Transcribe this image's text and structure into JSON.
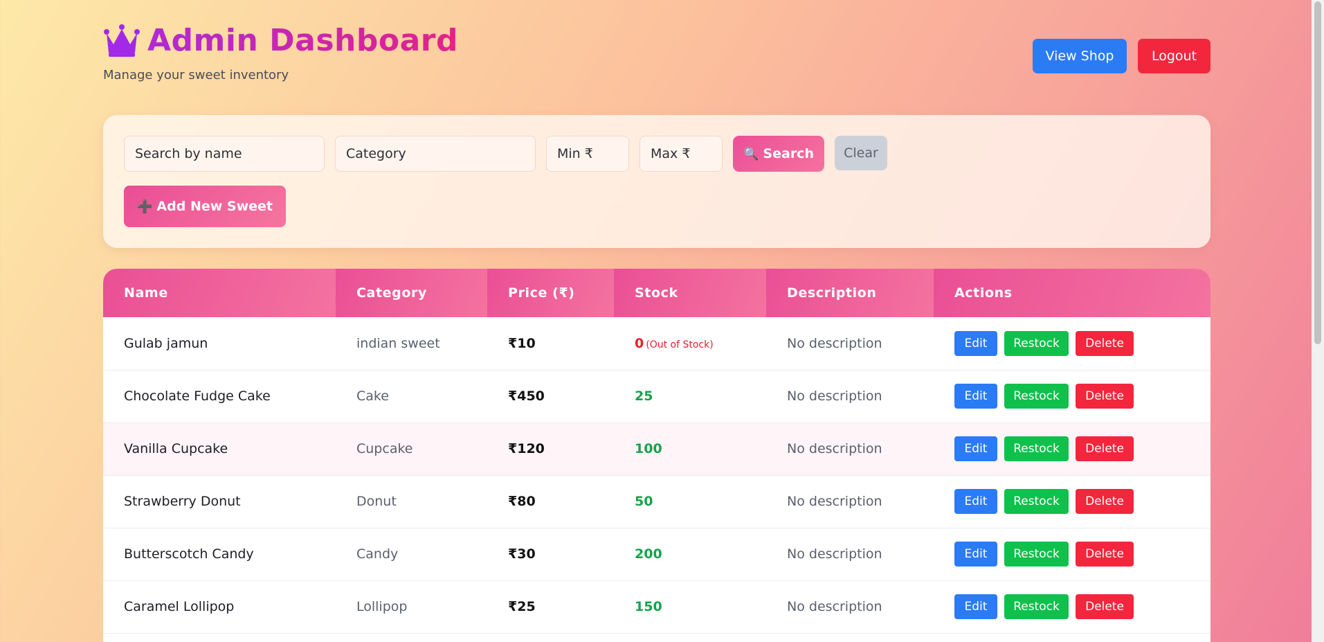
{
  "header": {
    "title": "Admin Dashboard",
    "subtitle": "Manage your sweet inventory",
    "icon": "crown-icon",
    "view_shop_label": "View Shop",
    "logout_label": "Logout"
  },
  "filters": {
    "name_placeholder": "Search by name",
    "category_placeholder": "Category",
    "min_placeholder": "Min ₹",
    "max_placeholder": "Max ₹",
    "search_label": "Search",
    "search_icon": "🔍",
    "clear_label": "Clear",
    "add_label": "Add New Sweet",
    "add_icon": "➕"
  },
  "table": {
    "columns": [
      "Name",
      "Category",
      "Price (₹)",
      "Stock",
      "Description",
      "Actions"
    ],
    "action_labels": {
      "edit": "Edit",
      "restock": "Restock",
      "delete": "Delete"
    },
    "rows": [
      {
        "name": "Gulab jamun",
        "category": "indian sweet",
        "price": "₹10",
        "stock": "0",
        "stock_note": "(Out of Stock)",
        "description": "No description"
      },
      {
        "name": "Chocolate Fudge Cake",
        "category": "Cake",
        "price": "₹450",
        "stock": "25",
        "stock_note": "",
        "description": "No description"
      },
      {
        "name": "Vanilla Cupcake",
        "category": "Cupcake",
        "price": "₹120",
        "stock": "100",
        "stock_note": "",
        "description": "No description"
      },
      {
        "name": "Strawberry Donut",
        "category": "Donut",
        "price": "₹80",
        "stock": "50",
        "stock_note": "",
        "description": "No description"
      },
      {
        "name": "Butterscotch Candy",
        "category": "Candy",
        "price": "₹30",
        "stock": "200",
        "stock_note": "",
        "description": "No description"
      },
      {
        "name": "Caramel Lollipop",
        "category": "Lollipop",
        "price": "₹25",
        "stock": "150",
        "stock_note": "",
        "description": "No description"
      }
    ]
  },
  "colors": {
    "primary_blue": "#2b7bf5",
    "danger_red": "#f2263d",
    "success_green": "#10c04c",
    "accent_pink": "#ea4f95"
  }
}
